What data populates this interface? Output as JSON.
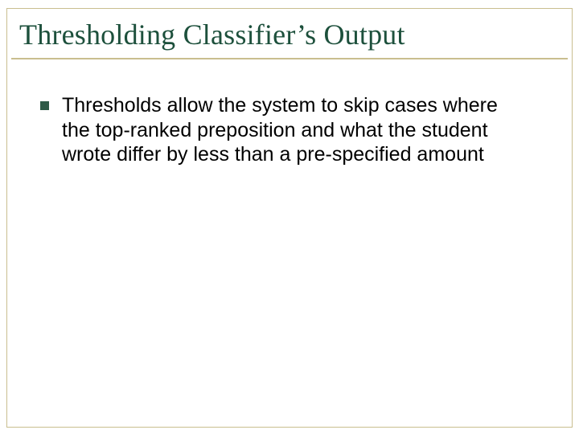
{
  "slide": {
    "title": "Thresholding Classifier’s Output",
    "bullets": [
      {
        "text": "Thresholds allow the system to skip cases where the top-ranked preposition and what the student wrote differ by less than a pre-specified amount"
      }
    ]
  }
}
